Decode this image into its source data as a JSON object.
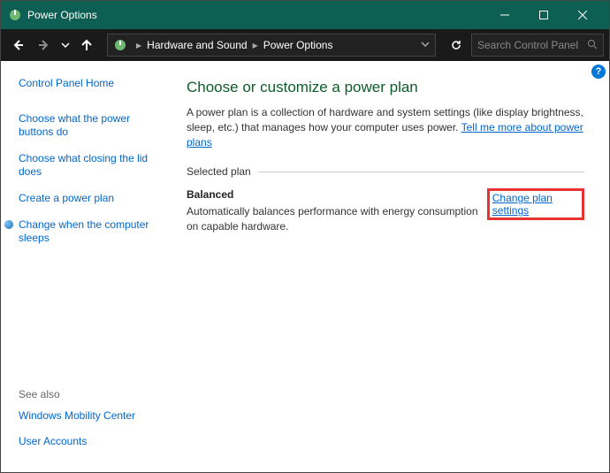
{
  "window": {
    "title": "Power Options"
  },
  "address": {
    "crumb1": "Hardware and Sound",
    "crumb2": "Power Options"
  },
  "search": {
    "placeholder": "Search Control Panel"
  },
  "sidebar": {
    "home": "Control Panel Home",
    "links": [
      "Choose what the power buttons do",
      "Choose what closing the lid does",
      "Create a power plan",
      "Change when the computer sleeps"
    ],
    "seealso_label": "See also",
    "seealso": [
      "Windows Mobility Center",
      "User Accounts"
    ]
  },
  "main": {
    "heading": "Choose or customize a power plan",
    "desc_pre": "A power plan is a collection of hardware and system settings (like display brightness, sleep, etc.) that manages how your computer uses power. ",
    "desc_link": "Tell me more about power plans",
    "section_label": "Selected plan",
    "plan_name": "Balanced",
    "plan_desc": "Automatically balances performance with energy consumption on capable hardware.",
    "change_link": "Change plan settings"
  }
}
